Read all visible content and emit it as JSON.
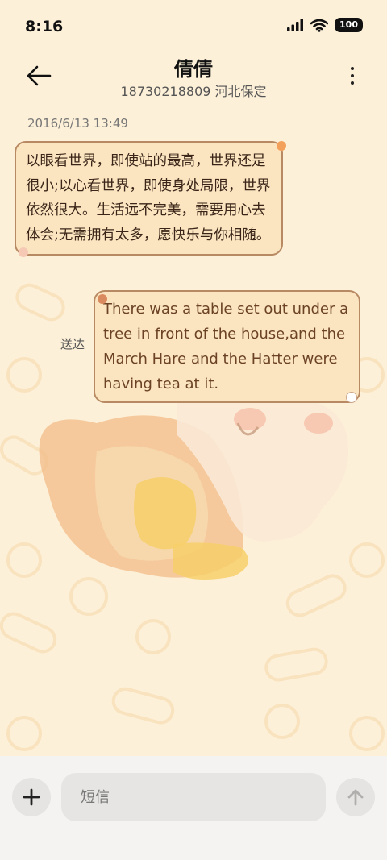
{
  "status_bar": {
    "time": "8:16",
    "battery": "100",
    "icons": [
      "signal-icon",
      "wifi-icon",
      "battery-icon"
    ]
  },
  "header": {
    "contact_name": "倩倩",
    "contact_info": "18730218809 河北保定",
    "icons": [
      "back-arrow-icon",
      "more-vertical-icon"
    ]
  },
  "conversation": {
    "timestamp": "2016/6/13 13:49",
    "messages": [
      {
        "direction": "incoming",
        "text": "以眼看世界，即使站的最高，世界还是很小;以心看世界，即使身处局限，世界依然很大。生活远不完美，需要用心去体会;无需拥有太多，愿快乐与你相随。"
      },
      {
        "direction": "outgoing",
        "text": "There was a table set out under a tree in front of the house,and the March Hare and the Hatter were having tea at it.",
        "status": "送达"
      }
    ]
  },
  "composer": {
    "placeholder": "短信",
    "value": "",
    "icons": [
      "plus-icon",
      "send-arrow-icon"
    ]
  },
  "colors": {
    "background": "#fdf0d8",
    "bubble_fill": "#fbe4c0",
    "bubble_border": "#b88a63",
    "bottom_bar": "#f4f3f1"
  }
}
